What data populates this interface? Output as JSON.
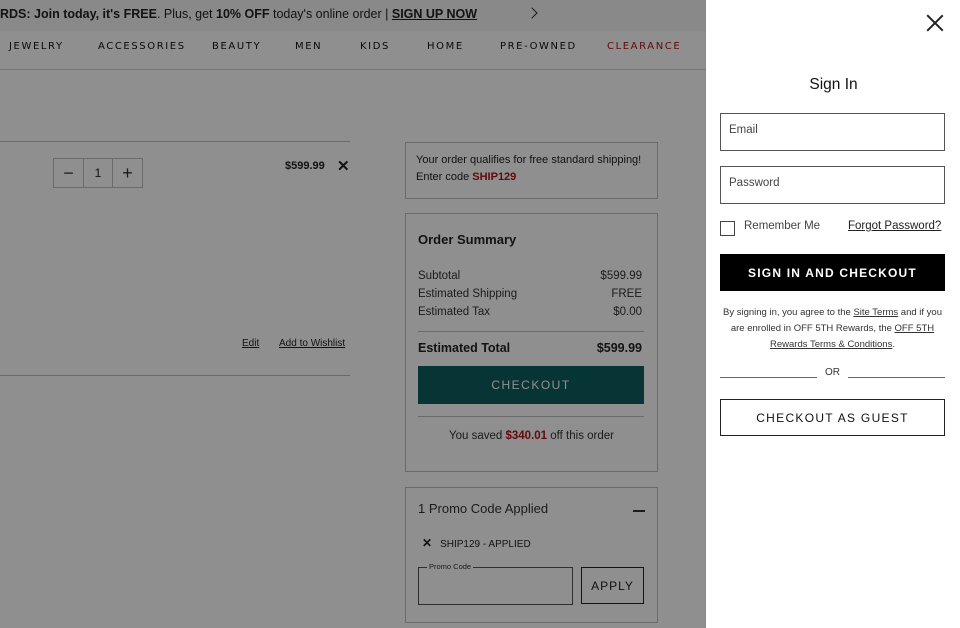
{
  "promo_bar": {
    "prefix": "RDS: Join today, it's ",
    "free": "FREE",
    "mid": ". Plus, get ",
    "off": "10% OFF",
    "suffix": " today's online order | ",
    "signup": "SIGN UP NOW"
  },
  "nav": {
    "items": [
      "JEWELRY",
      "ACCESSORIES",
      "BEAUTY",
      "MEN",
      "KIDS",
      "HOME",
      "PRE-OWNED",
      "CLEARANCE"
    ]
  },
  "cart_item": {
    "quantity": "1",
    "minus": "−",
    "plus": "+",
    "price": "$599.99",
    "remove": "✕",
    "edit": "Edit",
    "wishlist": "Add to Wishlist"
  },
  "shipping_notice": {
    "line1": "Your order qualifies for free standard shipping!",
    "line2_prefix": "Enter code ",
    "code": "SHIP129"
  },
  "order_summary": {
    "title": "Order Summary",
    "rows": [
      {
        "label": "Subtotal",
        "value": "$599.99"
      },
      {
        "label": "Estimated Shipping",
        "value": "FREE"
      },
      {
        "label": "Estimated Tax",
        "value": "$0.00"
      }
    ],
    "total_label": "Estimated Total",
    "total_value": "$599.99",
    "checkout_label": "CHECKOUT",
    "saved_prefix": "You saved ",
    "saved_amount": "$340.01",
    "saved_suffix": " off this order"
  },
  "promo": {
    "header": "1 Promo Code Applied",
    "applied_code": "SHIP129 - APPLIED",
    "input_label": "Promo Code",
    "apply_label": "APPLY"
  },
  "sign_in": {
    "title": "Sign In",
    "email_placeholder": "Email",
    "password_placeholder": "Password",
    "remember_label": "Remember Me",
    "forgot_label": "Forgot Password?",
    "signin_button": "SIGN IN AND CHECKOUT",
    "terms_prefix": "By signing in, you agree to the ",
    "terms_link": "Site Terms",
    "terms_mid": " and if you are enrolled in OFF 5TH Rewards, the ",
    "rewards_link": "OFF 5TH Rewards Terms & Conditions",
    "terms_end": ".",
    "or_label": "OR",
    "guest_button": "CHECKOUT AS GUEST"
  },
  "colors": {
    "accent_teal": "#0e5f5f",
    "accent_red": "#b0121b",
    "overlay": "rgba(0,0,0,0.44)"
  }
}
